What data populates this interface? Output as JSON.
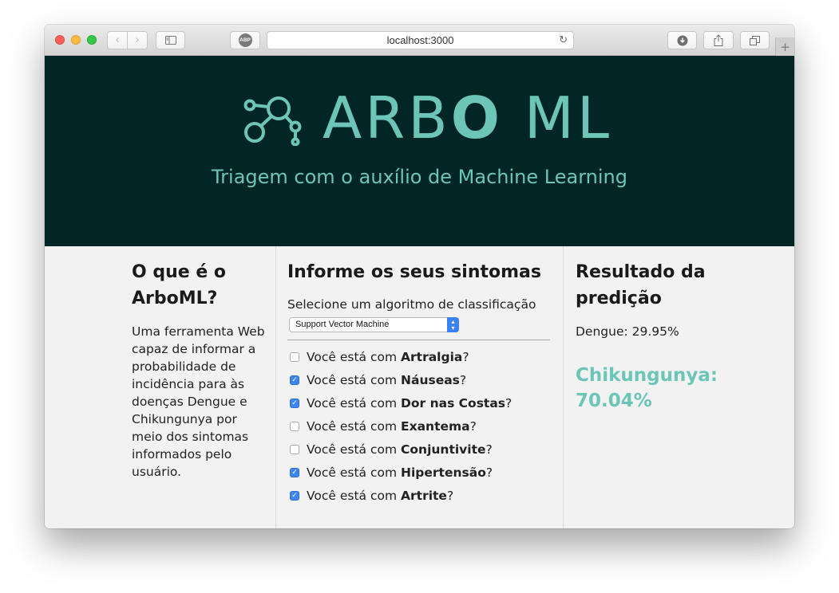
{
  "browser": {
    "url": "localhost:3000",
    "abp_label": "ABP"
  },
  "hero": {
    "logo_part1": "ARB",
    "logo_part2": "O",
    "logo_part3": " ML",
    "tagline": "Triagem com o auxílio de Machine Learning"
  },
  "about": {
    "title": "O que é o ArboML?",
    "text": "Uma ferramenta Web capaz de informar a probabilidade de incidência para às doenças Dengue e Chikungunya por meio dos sintomas informados pelo usuário."
  },
  "form": {
    "title": "Informe os seus sintomas",
    "select_label": "Selecione um algoritmo de classificação",
    "selected_algorithm": "Support Vector Machine",
    "question_prefix": "Você está com ",
    "question_suffix": "?",
    "symptoms": [
      {
        "name": "Artralgia",
        "checked": false
      },
      {
        "name": "Náuseas",
        "checked": true
      },
      {
        "name": "Dor nas Costas",
        "checked": true
      },
      {
        "name": "Exantema",
        "checked": false
      },
      {
        "name": "Conjuntivite",
        "checked": false
      },
      {
        "name": "Hipertensão",
        "checked": true
      },
      {
        "name": "Artrite",
        "checked": true
      }
    ]
  },
  "result": {
    "title": "Resultado da predição",
    "dengue": "Dengue: 29.95%",
    "chikungunya_label": "Chikungunya:",
    "chikungunya_value": "70.04%"
  },
  "colors": {
    "hero_bg": "#022626",
    "accent": "#6cc5b6",
    "checkbox_checked": "#3d86f0"
  }
}
